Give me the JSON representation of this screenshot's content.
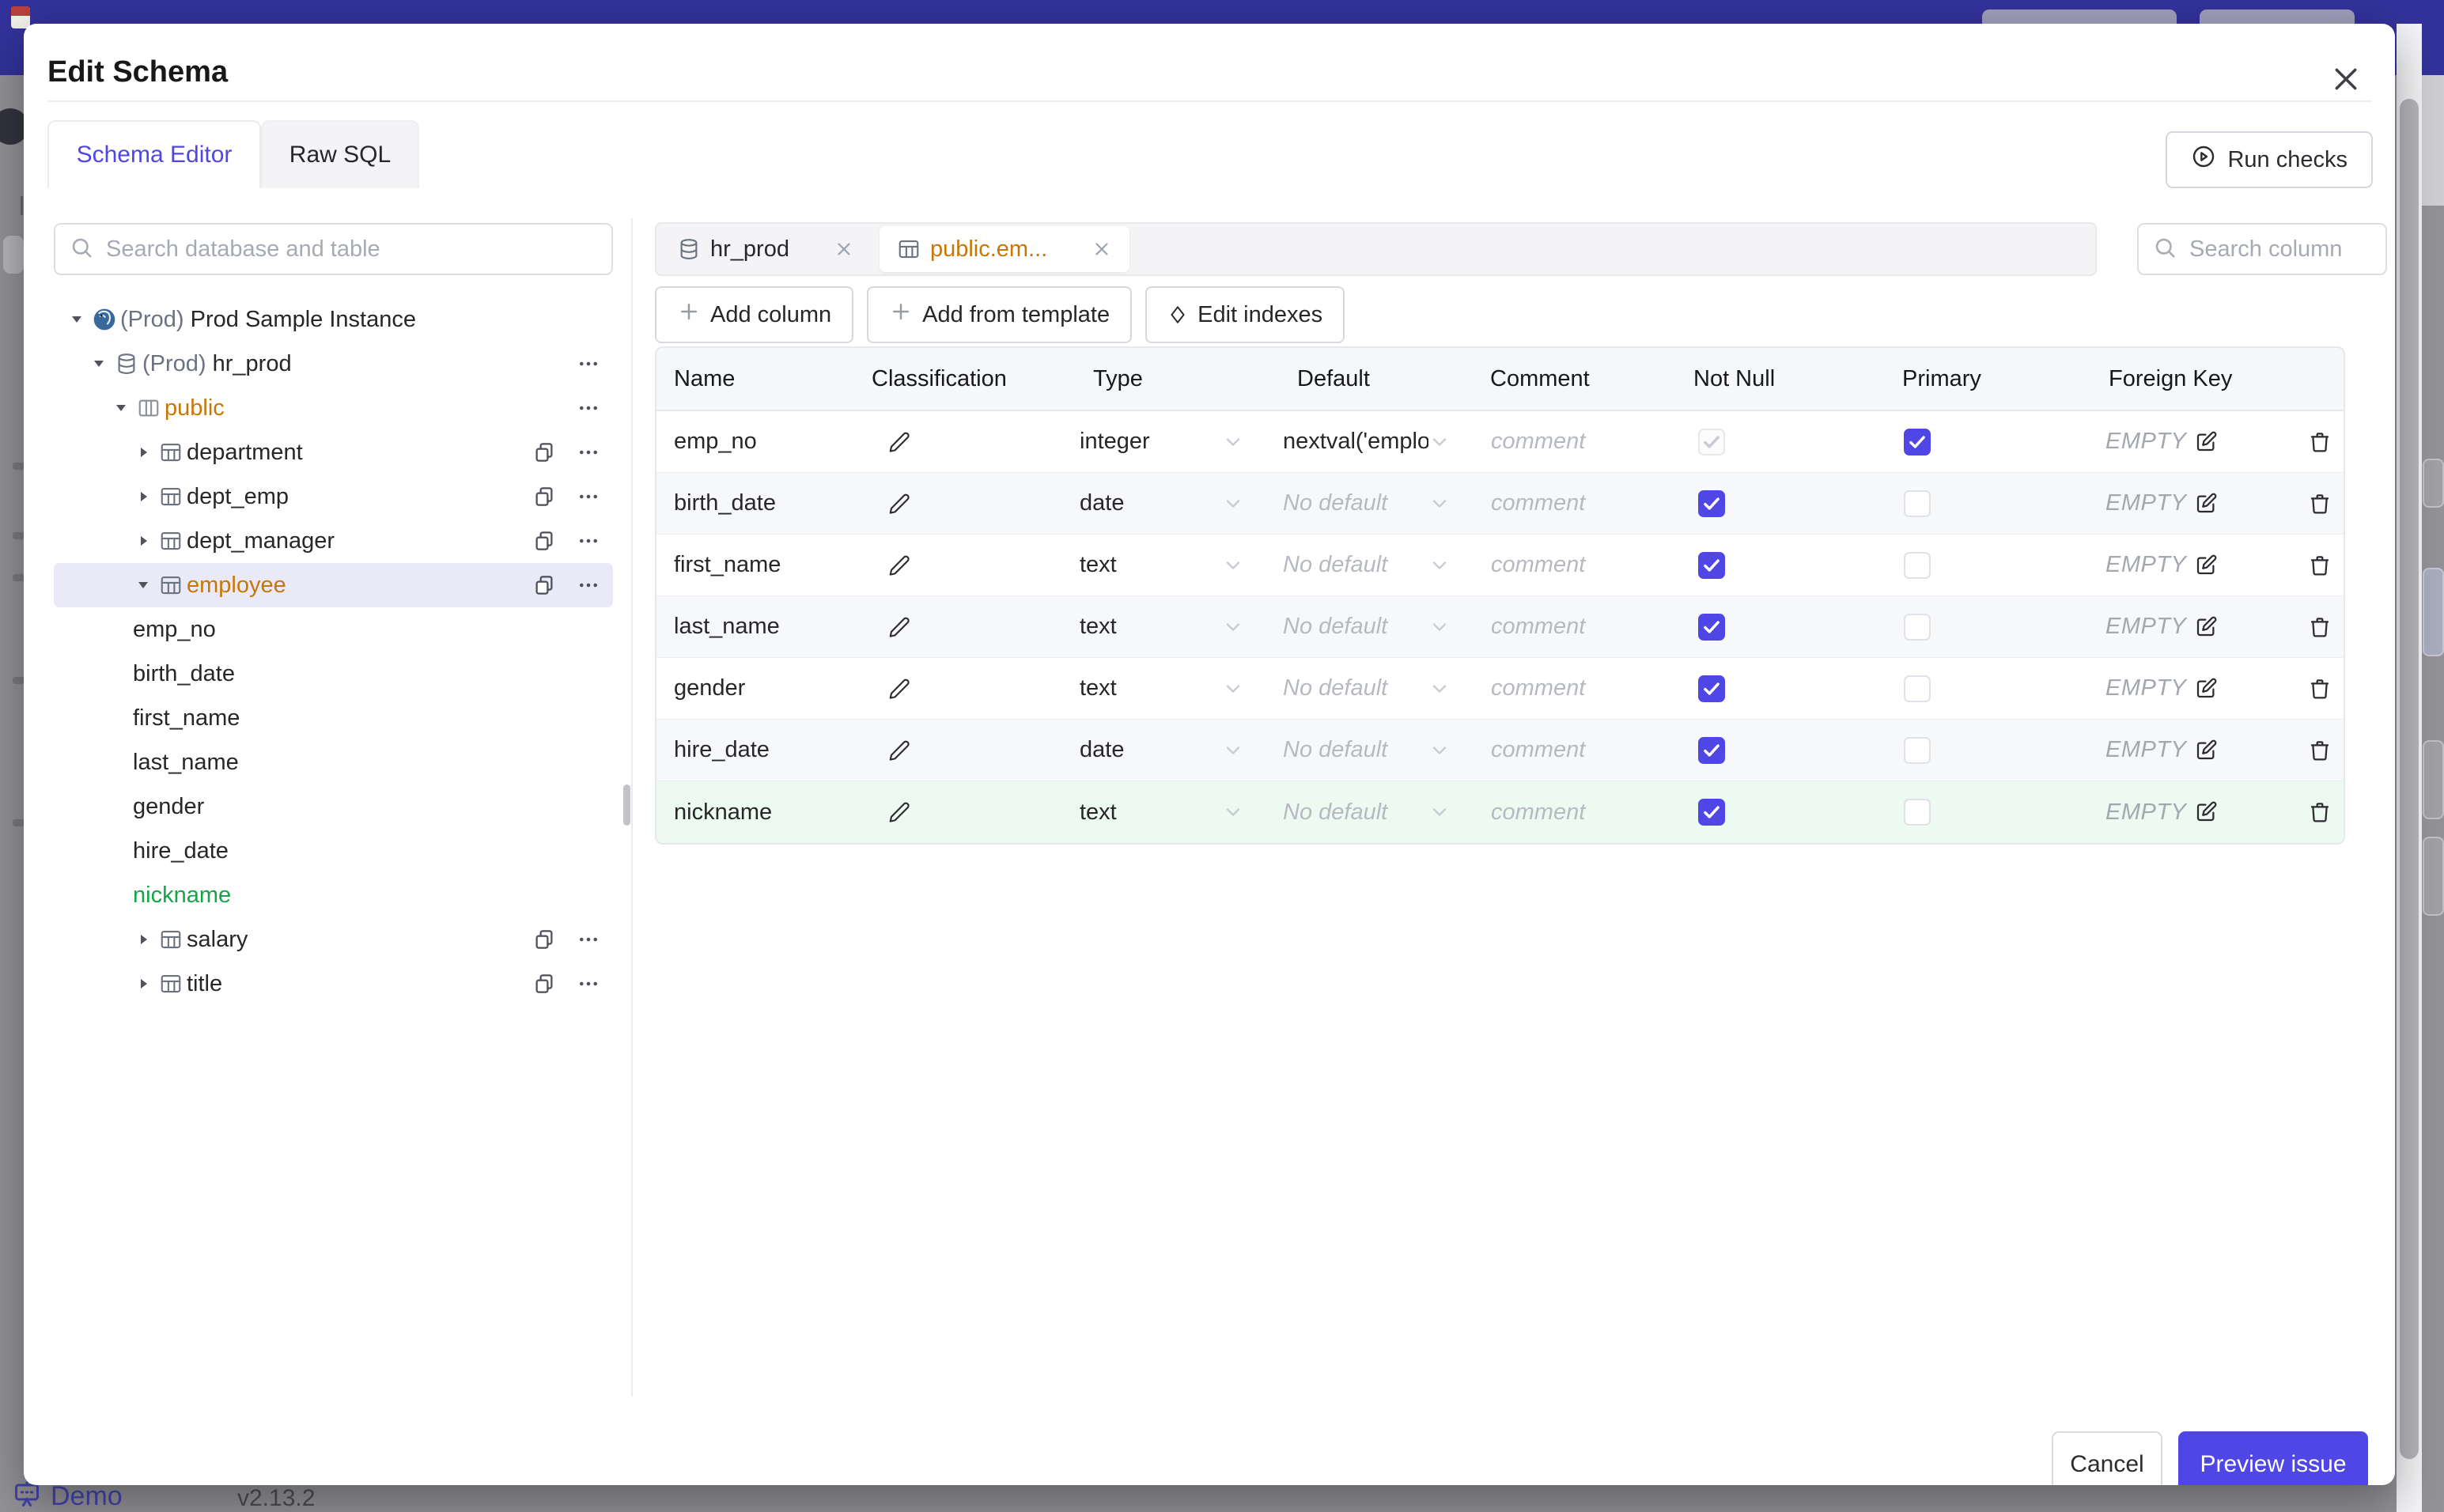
{
  "colors": {
    "accent": "#4f46e5",
    "amber": "#c77708",
    "green": "#16a34a",
    "topbar": "#32329b",
    "row_green": "#edfaf2",
    "row_alt": "#f7f8fa",
    "selected_row": "#e9e9f8"
  },
  "background": {
    "demo_label": "Demo",
    "version": "v2.13.2"
  },
  "modal": {
    "title": "Edit Schema",
    "run_checks": "Run checks",
    "tabs": [
      {
        "label": "Schema Editor"
      },
      {
        "label": "Raw SQL"
      }
    ],
    "footer": {
      "cancel": "Cancel",
      "submit": "Preview issue"
    }
  },
  "sidebar": {
    "search_placeholder": "Search database and table",
    "tree": [
      {
        "level": 0,
        "caret": "down",
        "icon": "postgres",
        "prefix": "(Prod) ",
        "label": "Prod Sample Instance"
      },
      {
        "level": 1,
        "caret": "down",
        "icon": "database",
        "prefix": "(Prod) ",
        "label": "hr_prod",
        "actions": [
          "more"
        ]
      },
      {
        "level": 2,
        "caret": "down",
        "icon": "schema",
        "label": "public",
        "color": "amber",
        "actions": [
          "more"
        ]
      },
      {
        "level": 3,
        "caret": "right",
        "icon": "table",
        "label": "department",
        "actions": [
          "copy",
          "more"
        ]
      },
      {
        "level": 3,
        "caret": "right",
        "icon": "table",
        "label": "dept_emp",
        "actions": [
          "copy",
          "more"
        ]
      },
      {
        "level": 3,
        "caret": "right",
        "icon": "table",
        "label": "dept_manager",
        "actions": [
          "copy",
          "more"
        ]
      },
      {
        "level": 3,
        "caret": "down",
        "icon": "table",
        "label": "employee",
        "color": "amber",
        "selected": true,
        "actions": [
          "copy",
          "more"
        ]
      },
      {
        "level": 4,
        "label": "emp_no"
      },
      {
        "level": 4,
        "label": "birth_date"
      },
      {
        "level": 4,
        "label": "first_name"
      },
      {
        "level": 4,
        "label": "last_name"
      },
      {
        "level": 4,
        "label": "gender"
      },
      {
        "level": 4,
        "label": "hire_date"
      },
      {
        "level": 4,
        "label": "nickname",
        "color": "green"
      },
      {
        "level": 3,
        "caret": "right",
        "icon": "table",
        "label": "salary",
        "actions": [
          "copy",
          "more"
        ]
      },
      {
        "level": 3,
        "caret": "right",
        "icon": "table",
        "label": "title",
        "actions": [
          "copy",
          "more"
        ]
      }
    ]
  },
  "main": {
    "tabs": [
      {
        "label": "hr_prod",
        "icon": "database",
        "active": false
      },
      {
        "label": "public.em...",
        "icon": "table",
        "active": true
      }
    ],
    "search_placeholder": "Search column",
    "toolbar": [
      {
        "label": "Add column",
        "icon": "plus"
      },
      {
        "label": "Add from template",
        "icon": "plus"
      },
      {
        "label": "Edit indexes",
        "icon": "diamond"
      }
    ],
    "table": {
      "headers": [
        "Name",
        "Classification",
        "Type",
        "Default",
        "Comment",
        "Not Null",
        "Primary",
        "Foreign Key",
        ""
      ],
      "comment_placeholder": "comment",
      "fk_empty": "EMPTY",
      "rows": [
        {
          "name": "emp_no",
          "type": "integer",
          "default": "nextval('employ",
          "default_is_set": true,
          "not_null": true,
          "not_null_disabled": true,
          "primary": true
        },
        {
          "name": "birth_date",
          "type": "date",
          "default": "No default",
          "not_null": true,
          "primary": false
        },
        {
          "name": "first_name",
          "type": "text",
          "default": "No default",
          "not_null": true,
          "primary": false
        },
        {
          "name": "last_name",
          "type": "text",
          "default": "No default",
          "not_null": true,
          "primary": false
        },
        {
          "name": "gender",
          "type": "text",
          "default": "No default",
          "not_null": true,
          "primary": false
        },
        {
          "name": "hire_date",
          "type": "date",
          "default": "No default",
          "not_null": true,
          "primary": false
        },
        {
          "name": "nickname",
          "type": "text",
          "default": "No default",
          "not_null": true,
          "primary": false,
          "highlight": "green"
        }
      ]
    }
  }
}
